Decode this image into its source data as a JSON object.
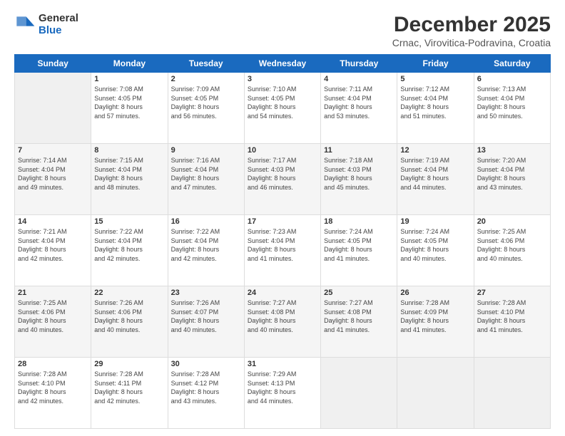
{
  "header": {
    "logo_general": "General",
    "logo_blue": "Blue",
    "title": "December 2025",
    "subtitle": "Crnac, Virovitica-Podravina, Croatia"
  },
  "weekdays": [
    "Sunday",
    "Monday",
    "Tuesday",
    "Wednesday",
    "Thursday",
    "Friday",
    "Saturday"
  ],
  "weeks": [
    [
      {
        "day": "",
        "info": ""
      },
      {
        "day": "1",
        "info": "Sunrise: 7:08 AM\nSunset: 4:05 PM\nDaylight: 8 hours\nand 57 minutes."
      },
      {
        "day": "2",
        "info": "Sunrise: 7:09 AM\nSunset: 4:05 PM\nDaylight: 8 hours\nand 56 minutes."
      },
      {
        "day": "3",
        "info": "Sunrise: 7:10 AM\nSunset: 4:05 PM\nDaylight: 8 hours\nand 54 minutes."
      },
      {
        "day": "4",
        "info": "Sunrise: 7:11 AM\nSunset: 4:04 PM\nDaylight: 8 hours\nand 53 minutes."
      },
      {
        "day": "5",
        "info": "Sunrise: 7:12 AM\nSunset: 4:04 PM\nDaylight: 8 hours\nand 51 minutes."
      },
      {
        "day": "6",
        "info": "Sunrise: 7:13 AM\nSunset: 4:04 PM\nDaylight: 8 hours\nand 50 minutes."
      }
    ],
    [
      {
        "day": "7",
        "info": "Sunrise: 7:14 AM\nSunset: 4:04 PM\nDaylight: 8 hours\nand 49 minutes."
      },
      {
        "day": "8",
        "info": "Sunrise: 7:15 AM\nSunset: 4:04 PM\nDaylight: 8 hours\nand 48 minutes."
      },
      {
        "day": "9",
        "info": "Sunrise: 7:16 AM\nSunset: 4:04 PM\nDaylight: 8 hours\nand 47 minutes."
      },
      {
        "day": "10",
        "info": "Sunrise: 7:17 AM\nSunset: 4:03 PM\nDaylight: 8 hours\nand 46 minutes."
      },
      {
        "day": "11",
        "info": "Sunrise: 7:18 AM\nSunset: 4:03 PM\nDaylight: 8 hours\nand 45 minutes."
      },
      {
        "day": "12",
        "info": "Sunrise: 7:19 AM\nSunset: 4:04 PM\nDaylight: 8 hours\nand 44 minutes."
      },
      {
        "day": "13",
        "info": "Sunrise: 7:20 AM\nSunset: 4:04 PM\nDaylight: 8 hours\nand 43 minutes."
      }
    ],
    [
      {
        "day": "14",
        "info": "Sunrise: 7:21 AM\nSunset: 4:04 PM\nDaylight: 8 hours\nand 42 minutes."
      },
      {
        "day": "15",
        "info": "Sunrise: 7:22 AM\nSunset: 4:04 PM\nDaylight: 8 hours\nand 42 minutes."
      },
      {
        "day": "16",
        "info": "Sunrise: 7:22 AM\nSunset: 4:04 PM\nDaylight: 8 hours\nand 42 minutes."
      },
      {
        "day": "17",
        "info": "Sunrise: 7:23 AM\nSunset: 4:04 PM\nDaylight: 8 hours\nand 41 minutes."
      },
      {
        "day": "18",
        "info": "Sunrise: 7:24 AM\nSunset: 4:05 PM\nDaylight: 8 hours\nand 41 minutes."
      },
      {
        "day": "19",
        "info": "Sunrise: 7:24 AM\nSunset: 4:05 PM\nDaylight: 8 hours\nand 40 minutes."
      },
      {
        "day": "20",
        "info": "Sunrise: 7:25 AM\nSunset: 4:06 PM\nDaylight: 8 hours\nand 40 minutes."
      }
    ],
    [
      {
        "day": "21",
        "info": "Sunrise: 7:25 AM\nSunset: 4:06 PM\nDaylight: 8 hours\nand 40 minutes."
      },
      {
        "day": "22",
        "info": "Sunrise: 7:26 AM\nSunset: 4:06 PM\nDaylight: 8 hours\nand 40 minutes."
      },
      {
        "day": "23",
        "info": "Sunrise: 7:26 AM\nSunset: 4:07 PM\nDaylight: 8 hours\nand 40 minutes."
      },
      {
        "day": "24",
        "info": "Sunrise: 7:27 AM\nSunset: 4:08 PM\nDaylight: 8 hours\nand 40 minutes."
      },
      {
        "day": "25",
        "info": "Sunrise: 7:27 AM\nSunset: 4:08 PM\nDaylight: 8 hours\nand 41 minutes."
      },
      {
        "day": "26",
        "info": "Sunrise: 7:28 AM\nSunset: 4:09 PM\nDaylight: 8 hours\nand 41 minutes."
      },
      {
        "day": "27",
        "info": "Sunrise: 7:28 AM\nSunset: 4:10 PM\nDaylight: 8 hours\nand 41 minutes."
      }
    ],
    [
      {
        "day": "28",
        "info": "Sunrise: 7:28 AM\nSunset: 4:10 PM\nDaylight: 8 hours\nand 42 minutes."
      },
      {
        "day": "29",
        "info": "Sunrise: 7:28 AM\nSunset: 4:11 PM\nDaylight: 8 hours\nand 42 minutes."
      },
      {
        "day": "30",
        "info": "Sunrise: 7:28 AM\nSunset: 4:12 PM\nDaylight: 8 hours\nand 43 minutes."
      },
      {
        "day": "31",
        "info": "Sunrise: 7:29 AM\nSunset: 4:13 PM\nDaylight: 8 hours\nand 44 minutes."
      },
      {
        "day": "",
        "info": ""
      },
      {
        "day": "",
        "info": ""
      },
      {
        "day": "",
        "info": ""
      }
    ]
  ]
}
